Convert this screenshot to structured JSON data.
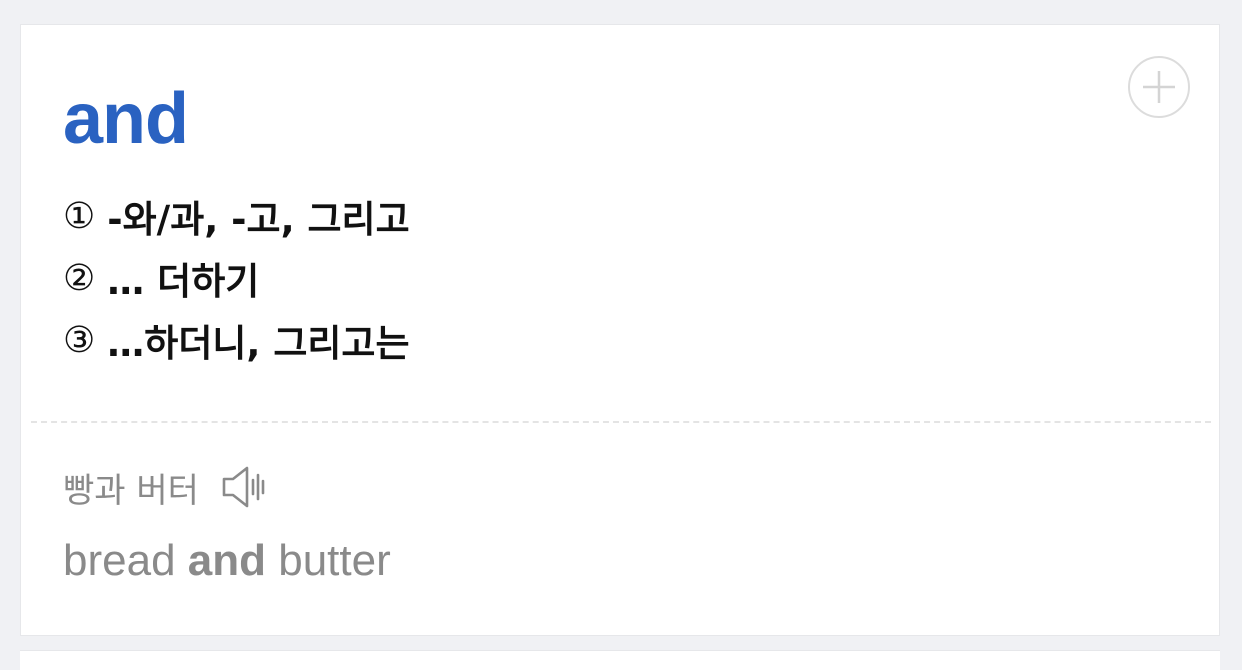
{
  "entry": {
    "headword": "and",
    "meanings": [
      {
        "num": "①",
        "text": "-와/과, -고, 그리고"
      },
      {
        "num": "②",
        "text": "… 더하기"
      },
      {
        "num": "③",
        "text": "…하더니, 그리고는"
      }
    ],
    "example": {
      "korean": "빵과 버터",
      "english_before": "bread ",
      "english_highlight": "and",
      "english_after": " butter"
    }
  },
  "icons": {
    "add": "plus-circle-icon",
    "audio": "speaker-icon"
  },
  "colors": {
    "headword": "#2a62c1",
    "meaning_text": "#111111",
    "example_text": "#8a8a8a",
    "background": "#f0f1f4",
    "card": "#ffffff"
  }
}
